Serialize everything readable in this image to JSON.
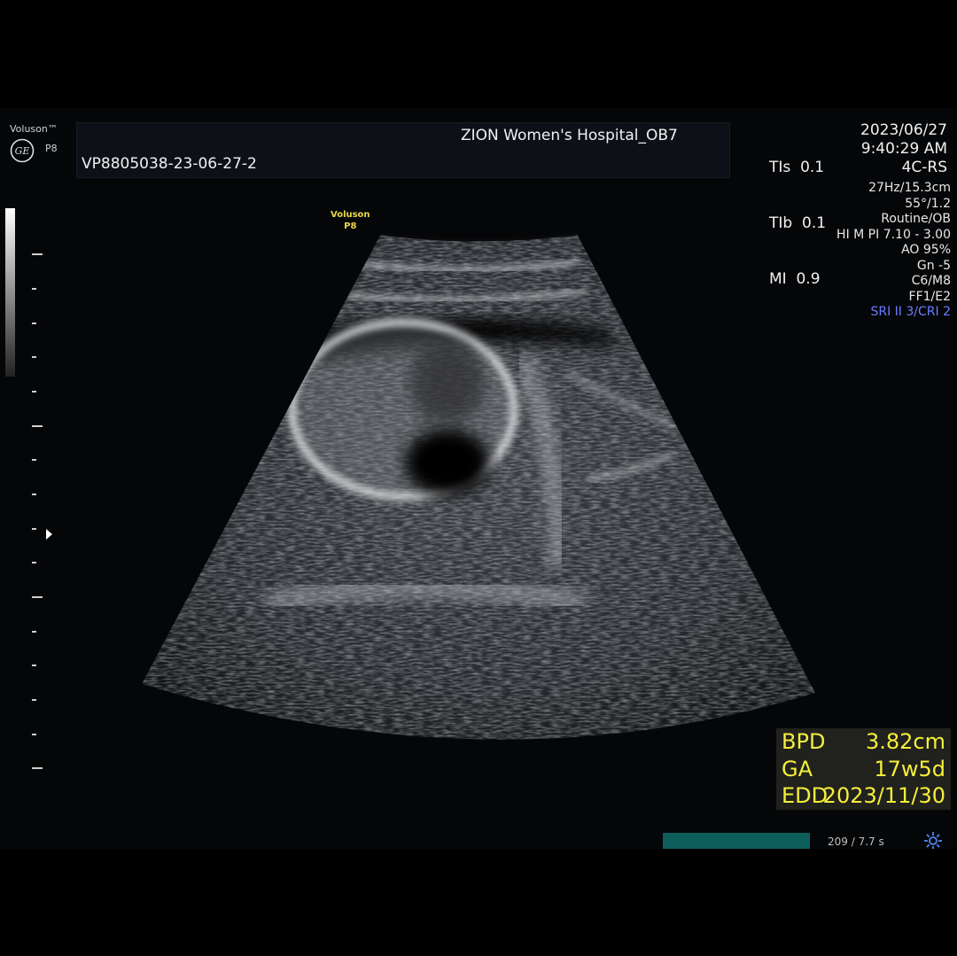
{
  "header": {
    "brand": "Voluson™",
    "probe": "P8",
    "hospital": "ZION Women's Hospital_OB7",
    "patient_id": "VP8805038-23-06-27-2",
    "acoustic": [
      "TIs  0.1",
      "TIb  0.1",
      "MI  0.9"
    ],
    "date": "2023/06/27",
    "time": "9:40:29 AM",
    "mode": "4C-RS"
  },
  "params": {
    "items": [
      "27Hz/15.3cm",
      "55°/1.2",
      "Routine/OB",
      "HI M PI 7.10 - 3.00",
      "AO 95%",
      "Gn  -5",
      "C6/M8",
      "FF1/E2"
    ],
    "sri": "SRI II 3/CRI 2"
  },
  "image_logo": {
    "brand": "Voluson",
    "probe": "P8"
  },
  "measurements": [
    {
      "label": "BPD",
      "value": "3.82cm"
    },
    {
      "label": "GA",
      "value": "17w5d"
    },
    {
      "label": "EDD",
      "value": "2023/11/30"
    }
  ],
  "cine": {
    "count": "209 / 7.7 s"
  },
  "icons": {
    "logo": "ge-logo-icon",
    "settings": "gear-icon"
  }
}
